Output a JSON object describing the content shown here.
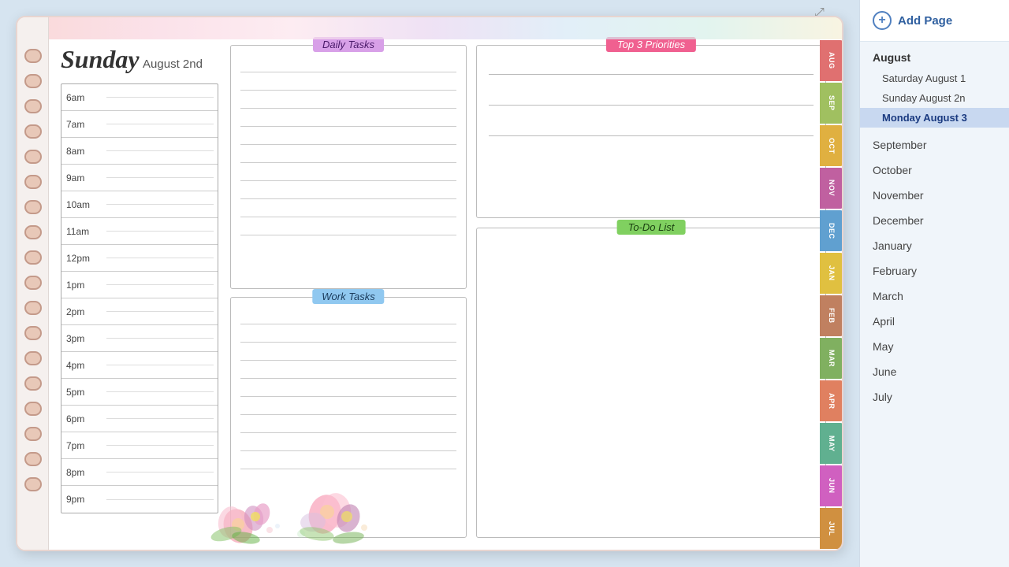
{
  "sidebar": {
    "add_page_label": "Add Page",
    "months": [
      {
        "name": "August",
        "days": [
          {
            "label": "Saturday August 1",
            "active": false
          },
          {
            "label": "Sunday August 2n",
            "active": false
          },
          {
            "label": "Monday August 3",
            "active": true
          }
        ]
      }
    ],
    "simple_months": [
      "September",
      "October",
      "November",
      "December",
      "January",
      "February",
      "March",
      "April",
      "May",
      "June",
      "July"
    ]
  },
  "planner": {
    "day_name": "Sunday",
    "date": "August 2nd",
    "times": [
      "6am",
      "7am",
      "8am",
      "9am",
      "10am",
      "11am",
      "12pm",
      "1pm",
      "2pm",
      "3pm",
      "4pm",
      "5pm",
      "6pm",
      "7pm",
      "8pm",
      "9pm"
    ],
    "daily_tasks_label": "Daily Tasks",
    "work_tasks_label": "Work Tasks",
    "top3_label": "Top 3 Priorities",
    "todo_label": "To-Do List"
  },
  "tabs": [
    {
      "id": "aug",
      "label": "AUG",
      "css_class": "tab-aug"
    },
    {
      "id": "sep",
      "label": "SEP",
      "css_class": "tab-sep"
    },
    {
      "id": "oct",
      "label": "OCT",
      "css_class": "tab-oct"
    },
    {
      "id": "nov",
      "label": "NOV",
      "css_class": "tab-nov"
    },
    {
      "id": "dec",
      "label": "DEC",
      "css_class": "tab-dec"
    },
    {
      "id": "jan",
      "label": "JAN",
      "css_class": "tab-jan"
    },
    {
      "id": "feb",
      "label": "FEB",
      "css_class": "tab-feb"
    },
    {
      "id": "mar",
      "label": "MAR",
      "css_class": "tab-mar"
    },
    {
      "id": "apr",
      "label": "APR",
      "css_class": "tab-apr"
    },
    {
      "id": "may",
      "label": "MAY",
      "css_class": "tab-may"
    },
    {
      "id": "jun",
      "label": "JUN",
      "css_class": "tab-jun"
    },
    {
      "id": "jul",
      "label": "JUL",
      "css_class": "tab-jul"
    }
  ]
}
